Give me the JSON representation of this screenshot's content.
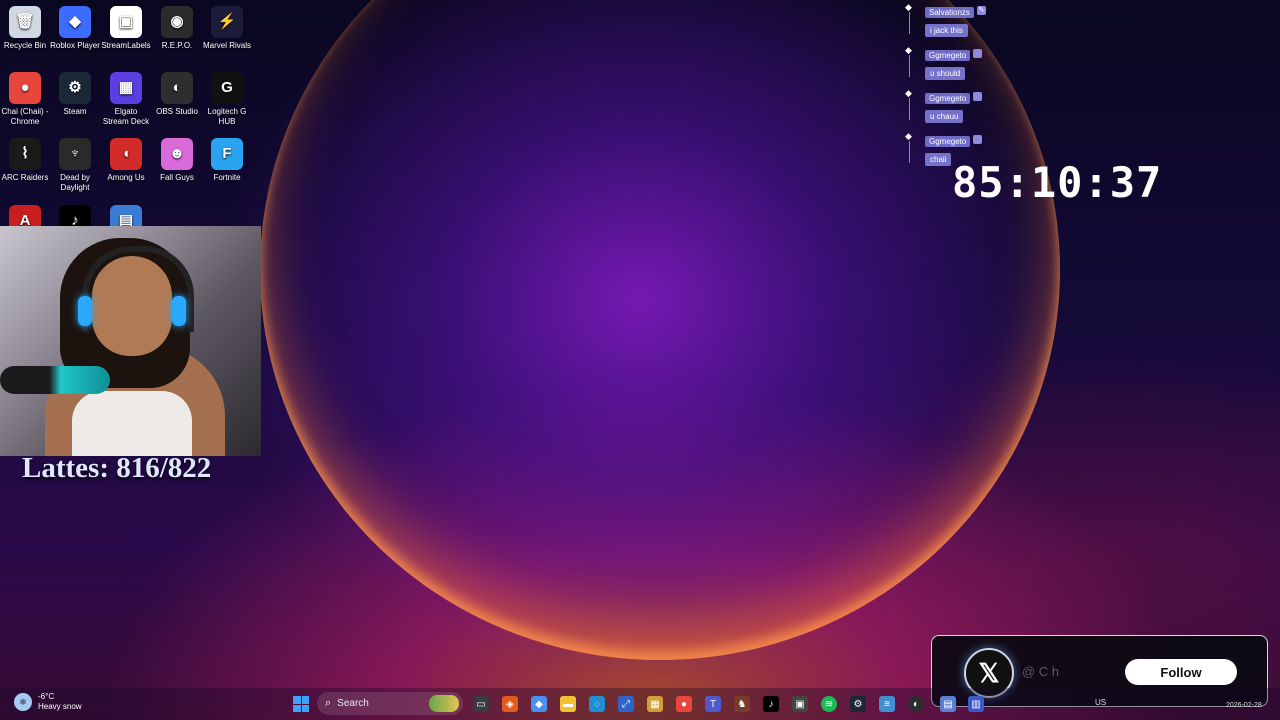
{
  "desktop_icons": [
    {
      "label": "Recycle Bin",
      "icon": "recycle-bin-icon",
      "color": "#cfd8e3",
      "glyph": "🗑"
    },
    {
      "label": "Roblox Player",
      "icon": "roblox-icon",
      "color": "#3b6cff",
      "glyph": "◆"
    },
    {
      "label": "StreamLabels",
      "icon": "streamlabels-icon",
      "color": "#ffffff",
      "glyph": "▣"
    },
    {
      "label": "R.E.P.O.",
      "icon": "repo-icon",
      "color": "#2b2b2b",
      "glyph": "◉"
    },
    {
      "label": "Marvel Rivals",
      "icon": "marvel-rivals-icon",
      "color": "#1c1c3a",
      "glyph": "⚡"
    },
    {
      "label": "Chai (Chaii) - Chrome",
      "icon": "chrome-icon",
      "color": "#e8453c",
      "glyph": "●"
    },
    {
      "label": "Steam",
      "icon": "steam-icon",
      "color": "#1b2838",
      "glyph": "⚙"
    },
    {
      "label": "Elgato Stream Deck",
      "icon": "stream-deck-icon",
      "color": "#5a3ee0",
      "glyph": "▦"
    },
    {
      "label": "OBS Studio",
      "icon": "obs-icon",
      "color": "#2e2e2e",
      "glyph": "◐"
    },
    {
      "label": "Logitech G HUB",
      "icon": "logitech-icon",
      "color": "#111111",
      "glyph": "G"
    },
    {
      "label": "ARC Raiders",
      "icon": "arc-raiders-icon",
      "color": "#1a1a1a",
      "glyph": "⌇"
    },
    {
      "label": "Dead by Daylight",
      "icon": "dead-by-daylight-icon",
      "color": "#2a2a2a",
      "glyph": "♆"
    },
    {
      "label": "Among Us",
      "icon": "among-us-icon",
      "color": "#d32a2a",
      "glyph": "◖"
    },
    {
      "label": "Fall Guys",
      "icon": "fall-guys-icon",
      "color": "#d86ad9",
      "glyph": "☻"
    },
    {
      "label": "Fortnite",
      "icon": "fortnite-icon",
      "color": "#2aa3f0",
      "glyph": "F"
    },
    {
      "label": "",
      "icon": "acrobat-icon",
      "color": "#c81e1e",
      "glyph": "A"
    },
    {
      "label": "",
      "icon": "tiktok-icon",
      "color": "#000000",
      "glyph": "♪"
    },
    {
      "label": "",
      "icon": "game-icon",
      "color": "#3a7bd5",
      "glyph": "▤"
    }
  ],
  "overlay": {
    "lattes": "Lattes: 816/822",
    "timer": "85:10:37"
  },
  "chat": [
    {
      "name": "Salvationzs",
      "badge": "✎",
      "text": "i jack this"
    },
    {
      "name": "Ggmegeto",
      "badge": "",
      "text": "u should"
    },
    {
      "name": "Ggmegeto",
      "badge": "",
      "text": "u chauu"
    },
    {
      "name": "Ggmegeto",
      "badge": "",
      "text": "chaii"
    }
  ],
  "follow_widget": {
    "handle": "@ C h",
    "button": "Follow"
  },
  "taskbar": {
    "weather_temp": "-6°C",
    "weather_desc": "Heavy snow",
    "search_label": "Search",
    "tray_lang": "US",
    "date": "2026-02-28"
  }
}
